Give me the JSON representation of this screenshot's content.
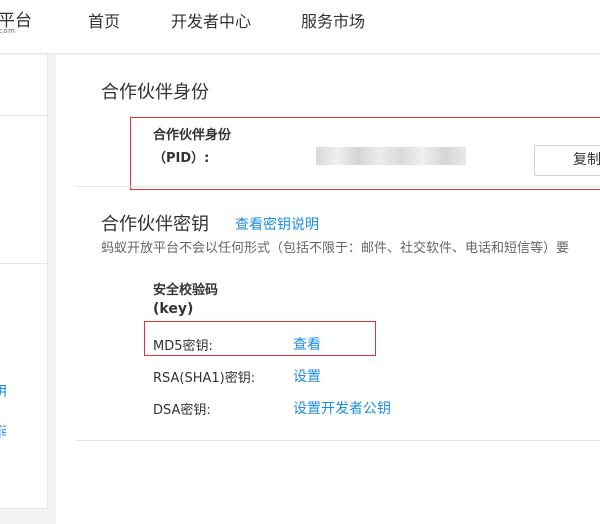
{
  "header": {
    "logo_text": "平台",
    "logo_sub": "com",
    "nav": [
      "首页",
      "开发者中心",
      "服务市场"
    ]
  },
  "sidebar": {
    "fragments": [
      "用",
      "间"
    ]
  },
  "identity": {
    "section_title": "合作伙伴身份",
    "pid_label": "合作伙伴身份",
    "pid_label2": "（PID）:",
    "copy_button": "复制"
  },
  "keys": {
    "section_title": "合作伙伴密钥",
    "help_link": "查看密钥说明",
    "notice": "蚂蚁开放平台不会以任何形式（包括不限于：邮件、社交软件、电话和短信等）要",
    "security_code_label": "安全校验码",
    "security_code_label2": "(key)",
    "rows": [
      {
        "label": "MD5密钥:",
        "action": "查看"
      },
      {
        "label": "RSA(SHA1)密钥:",
        "action": "设置"
      },
      {
        "label": "DSA密钥:",
        "action": "设置开发者公钥"
      }
    ]
  },
  "colors": {
    "link": "#1a8fe0",
    "highlight_border": "#d9363e",
    "background": "#f2f2f2"
  }
}
